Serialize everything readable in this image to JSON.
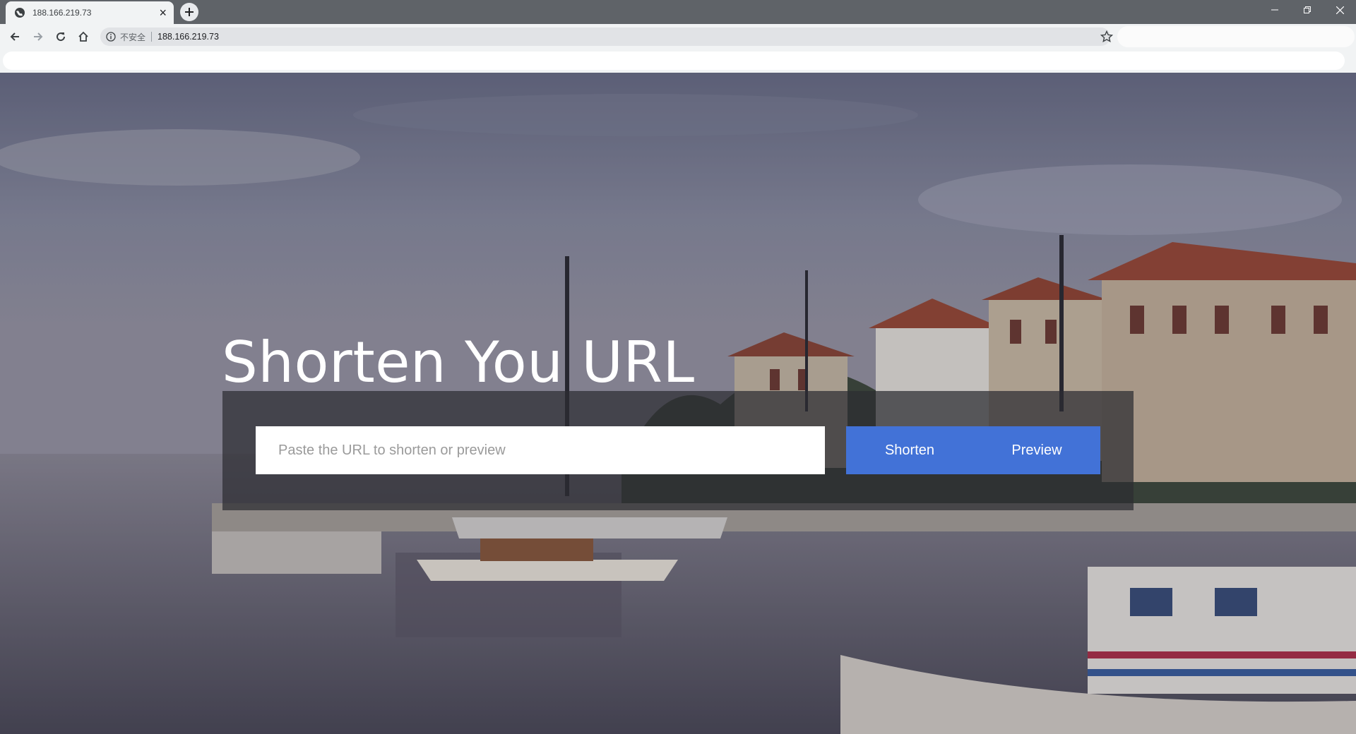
{
  "browser": {
    "tab_title": "188.166.219.73",
    "security_label": "不安全",
    "url": "188.166.219.73"
  },
  "hero": {
    "title": "Shorten You URL",
    "input_placeholder": "Paste the URL to shorten or preview",
    "shorten_label": "Shorten",
    "preview_label": "Preview"
  },
  "colors": {
    "button_bg": "#4272d7",
    "panel_bg": "rgba(45,45,50,0.72)"
  }
}
